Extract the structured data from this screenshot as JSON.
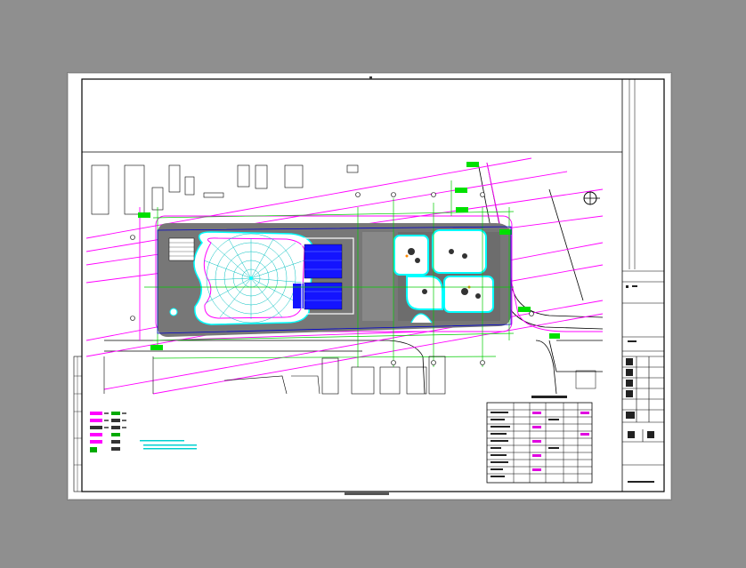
{
  "viewer": {
    "background_color": "#8f8f8f",
    "sheet_color": "#ffffff"
  },
  "drawing": {
    "type": "site-plan",
    "compass_icon": "north-arrow-icon",
    "colors": {
      "boundary": "#ff00ff",
      "dimension": "#00cc00",
      "water": "#00ffff",
      "paving": "#777777",
      "building_fill": "#0000ff",
      "linework": "#000000"
    }
  },
  "legend": {
    "rows": 8
  },
  "schedule_table": {
    "rows": 11,
    "columns": 5
  },
  "title_block": {
    "cells": 12
  }
}
